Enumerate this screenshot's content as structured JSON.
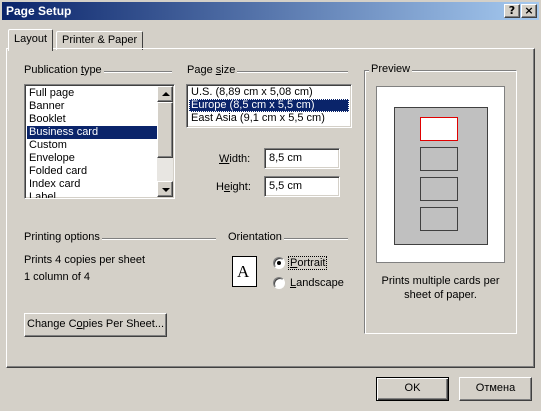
{
  "window": {
    "title": "Page Setup",
    "help_label": "?",
    "close_label": "×"
  },
  "tabs": [
    {
      "label": "Layout"
    },
    {
      "label": "Printer & Paper"
    }
  ],
  "publication_type": {
    "label_pre": "Publication ",
    "label_accel": "t",
    "label_post": "ype",
    "items": [
      {
        "label": "Full page"
      },
      {
        "label": "Banner"
      },
      {
        "label": "Booklet"
      },
      {
        "label": "Business card",
        "selected": true
      },
      {
        "label": "Custom"
      },
      {
        "label": "Envelope"
      },
      {
        "label": "Folded card"
      },
      {
        "label": "Index card"
      },
      {
        "label": "Label"
      }
    ],
    "scroll_position": 0
  },
  "page_size": {
    "label_pre": "Page ",
    "label_accel": "s",
    "label_post": "ize",
    "items": [
      {
        "label": "U.S. (8,89 cm x 5,08 cm)"
      },
      {
        "label": "Europe (8,5 cm x 5,5 cm)",
        "selected": true
      },
      {
        "label": "East Asia (9,1 cm x 5,5 cm)"
      }
    ]
  },
  "width": {
    "label_accel": "W",
    "label_post": "idth:",
    "value": "8,5 cm"
  },
  "height": {
    "label_pre": "H",
    "label_accel": "e",
    "label_post": "ight:",
    "value": "5,5 cm"
  },
  "printing_options": {
    "label": "Printing options",
    "line1": "Prints 4 copies per sheet",
    "line2": "1 column of 4",
    "button_pre": "Change C",
    "button_accel": "o",
    "button_post": "pies Per Sheet..."
  },
  "orientation": {
    "label": "Orientation",
    "glyph": "A",
    "portrait": {
      "label_accel": "P",
      "label_post": "ortrait",
      "checked": true
    },
    "landscape": {
      "label_accel": "L",
      "label_post": "andscape",
      "checked": false
    }
  },
  "preview": {
    "label": "Preview",
    "line1": "Prints multiple cards per",
    "line2": "sheet of paper.",
    "cards_count": 4,
    "active_card": 0,
    "colors": {
      "active_border": "#e00000",
      "card_fill": "#c0c0c0"
    }
  },
  "footer": {
    "ok_label": "OK",
    "cancel_label": "Отмена"
  },
  "colors": {
    "selection": "#0a246a",
    "face": "#d4d0c8",
    "title_start": "#0a246a",
    "title_end": "#a6caf0"
  }
}
